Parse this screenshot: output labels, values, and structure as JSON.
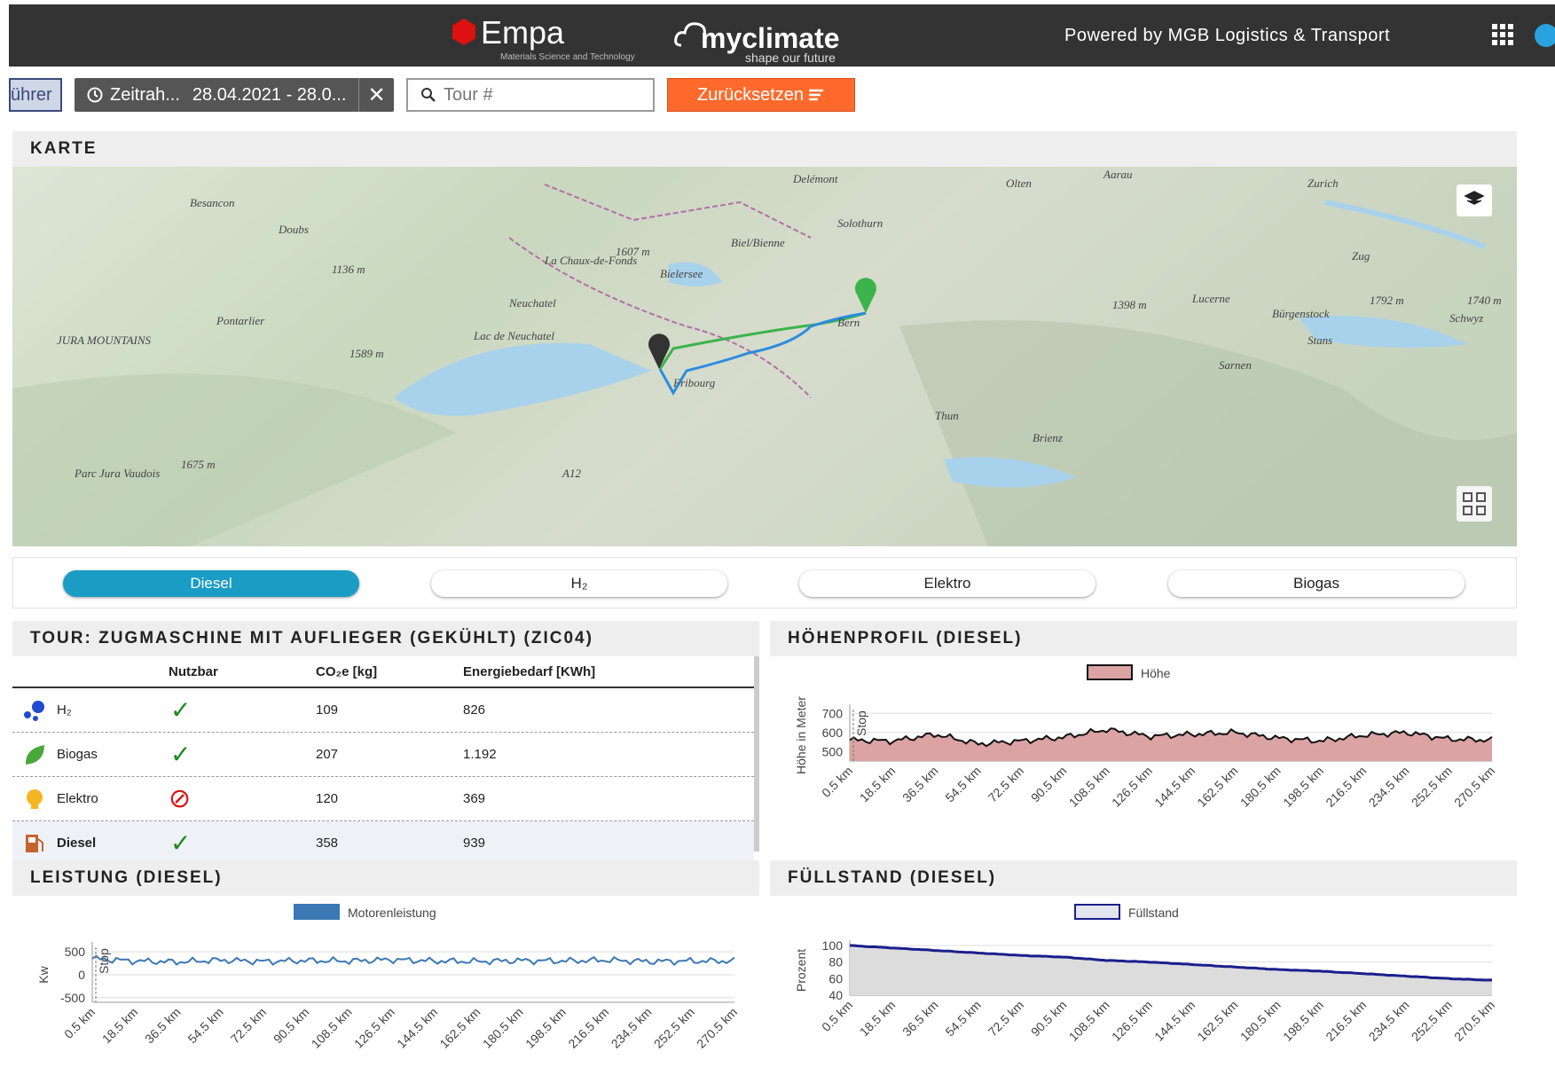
{
  "header": {
    "empa_name": "Empa",
    "empa_sub": "Materials Science and Technology",
    "myclimate_name": "myclimate",
    "myclimate_sub": "shape our future",
    "powered_by": "Powered by MGB Logistics & Transport",
    "apps_icon": "grid-icon",
    "user_icon": "user-icon"
  },
  "filters": {
    "driver_label": "ührer",
    "time_label": "Zeitrah...",
    "time_value": "28.04.2021 - 28.0...",
    "time_clear": "✕",
    "tour_placeholder": "Tour #",
    "reset_label": "Zurücksetzen"
  },
  "karte": {
    "title": "KARTE",
    "labels": [
      "Besancon",
      "Doubs",
      "Pontarlier",
      "JURA MOUNTAINS",
      "1589 m",
      "1136 m",
      "1675 m",
      "Parc Jura Vaudois",
      "Neuchatel",
      "Lac de Neuchatel",
      "La Chaux-de-Fonds",
      "1607 m",
      "Bielersee",
      "Biel/Bienne",
      "Solothurn",
      "Delémont",
      "Olten",
      "Aarau",
      "Zurich",
      "Zug",
      "Lucerne",
      "1398 m",
      "Sarnen",
      "Stans",
      "Schwyz",
      "1792 m",
      "1740 m",
      "Bürgenstock",
      "Brienz",
      "Thun",
      "Bern",
      "Fribourg",
      "A12"
    ]
  },
  "fuel_tabs": [
    "Diesel",
    "H₂",
    "Elektro",
    "Biogas"
  ],
  "tour": {
    "title": "TOUR: ZUGMASCHINE MIT AUFLIEGER (GEKÜHLT) (ZIC04)",
    "columns": [
      "Nutzbar",
      "CO₂e [kg]",
      "Energiebedarf [KWh]"
    ],
    "rows": [
      {
        "name": "H₂",
        "icon": "hydrogen-icon",
        "usable": "✓",
        "co2": "109",
        "energy": "826"
      },
      {
        "name": "Biogas",
        "icon": "leaf-icon",
        "usable": "✓",
        "co2": "207",
        "energy": "1.192"
      },
      {
        "name": "Elektro",
        "icon": "bulb-icon",
        "usable": "⊘",
        "co2": "120",
        "energy": "369"
      },
      {
        "name": "Diesel",
        "icon": "fuel-pump-icon",
        "usable": "✓",
        "co2": "358",
        "energy": "939"
      }
    ]
  },
  "charts_titles": {
    "hoehen": "HÖHENPROFIL (DIESEL)",
    "leistung": "LEISTUNG (DIESEL)",
    "fuell": "FÜLLSTAND (DIESEL)"
  },
  "chart_data": [
    {
      "type": "area",
      "title": "HÖHENPROFIL (DIESEL)",
      "series": [
        {
          "name": "Höhe",
          "color": "#d9a0a0"
        }
      ],
      "ylabel": "Höhe in Meter",
      "yticks": [
        500,
        600,
        700
      ],
      "ylim": [
        450,
        720
      ],
      "annotation": "Stop",
      "x": [
        "0.5 km",
        "18.5 km",
        "36.5 km",
        "54.5 km",
        "72.5 km",
        "90.5 km",
        "108.5 km",
        "126.5 km",
        "144.5 km",
        "162.5 km",
        "180.5 km",
        "198.5 km",
        "216.5 km",
        "234.5 km",
        "252.5 km",
        "270.5 km"
      ],
      "values": [
        560,
        555,
        590,
        540,
        555,
        575,
        615,
        580,
        590,
        600,
        570,
        555,
        585,
        600,
        565,
        560
      ]
    },
    {
      "type": "line",
      "title": "LEISTUNG (DIESEL)",
      "series": [
        {
          "name": "Motorenleistung",
          "color": "#3b78b4"
        }
      ],
      "ylabel": "Kw",
      "yticks": [
        -500,
        0,
        500
      ],
      "ylim": [
        -600,
        600
      ],
      "annotation": "Stop",
      "x": [
        "0.5 km",
        "18.5 km",
        "36.5 km",
        "54.5 km",
        "72.5 km",
        "90.5 km",
        "108.5 km",
        "126.5 km",
        "144.5 km",
        "162.5 km",
        "180.5 km",
        "198.5 km",
        "216.5 km",
        "234.5 km",
        "252.5 km",
        "270.5 km"
      ],
      "values": [
        350,
        300,
        280,
        320,
        290,
        310,
        300,
        330,
        300,
        290,
        310,
        300,
        320,
        290,
        300,
        300
      ]
    },
    {
      "type": "area",
      "title": "FÜLLSTAND (DIESEL)",
      "series": [
        {
          "name": "Füllstand",
          "color": "#1a1f8c"
        }
      ],
      "ylabel": "Prozent",
      "yticks": [
        40,
        60,
        80,
        100
      ],
      "ylim": [
        40,
        100
      ],
      "x": [
        "0.5 km",
        "18.5 km",
        "36.5 km",
        "54.5 km",
        "72.5 km",
        "90.5 km",
        "108.5 km",
        "126.5 km",
        "144.5 km",
        "162.5 km",
        "180.5 km",
        "198.5 km",
        "216.5 km",
        "234.5 km",
        "252.5 km",
        "270.5 km"
      ],
      "values": [
        100,
        97,
        94,
        91,
        88,
        86,
        82,
        80,
        77,
        74,
        71,
        69,
        66,
        63,
        60,
        58
      ]
    }
  ]
}
